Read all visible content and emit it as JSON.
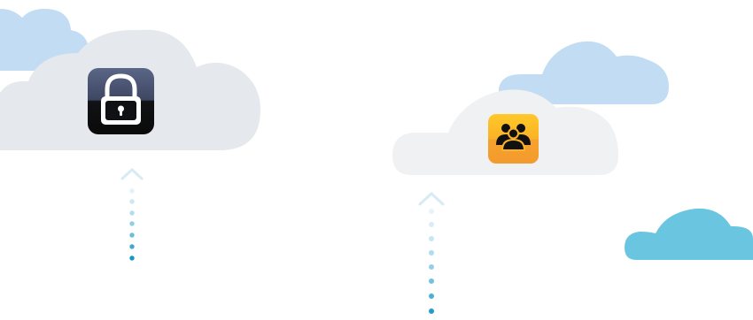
{
  "scene": {
    "colors": {
      "cloud_blue_light": "#c2dcf3",
      "cloud_grey": "#e5e8ec",
      "cloud_grey_light": "#f0f1f2",
      "cloud_cyan": "#6ac5e0",
      "arrow_chevron": "#d6ebf5",
      "dot_colors": [
        "#e3f1f8",
        "#cce7f3",
        "#b3dcee",
        "#93cde6",
        "#6cbcdc",
        "#3ea9d2",
        "#1497c8"
      ]
    },
    "icons": [
      {
        "name": "lock-app-icon",
        "semantic": "padlock",
        "tile_top": "#5a6687",
        "tile_bottom": "#0a0a0a",
        "glyph_color": "#ffffff"
      },
      {
        "name": "group-app-icon",
        "semantic": "people-group",
        "tile_top": "#ffc424",
        "tile_bottom": "#f39a2e",
        "glyph_color": "#111111"
      }
    ],
    "arrows": [
      {
        "name": "upload-arrow-left",
        "dots": 7
      },
      {
        "name": "upload-arrow-right",
        "dots": 9
      }
    ]
  }
}
